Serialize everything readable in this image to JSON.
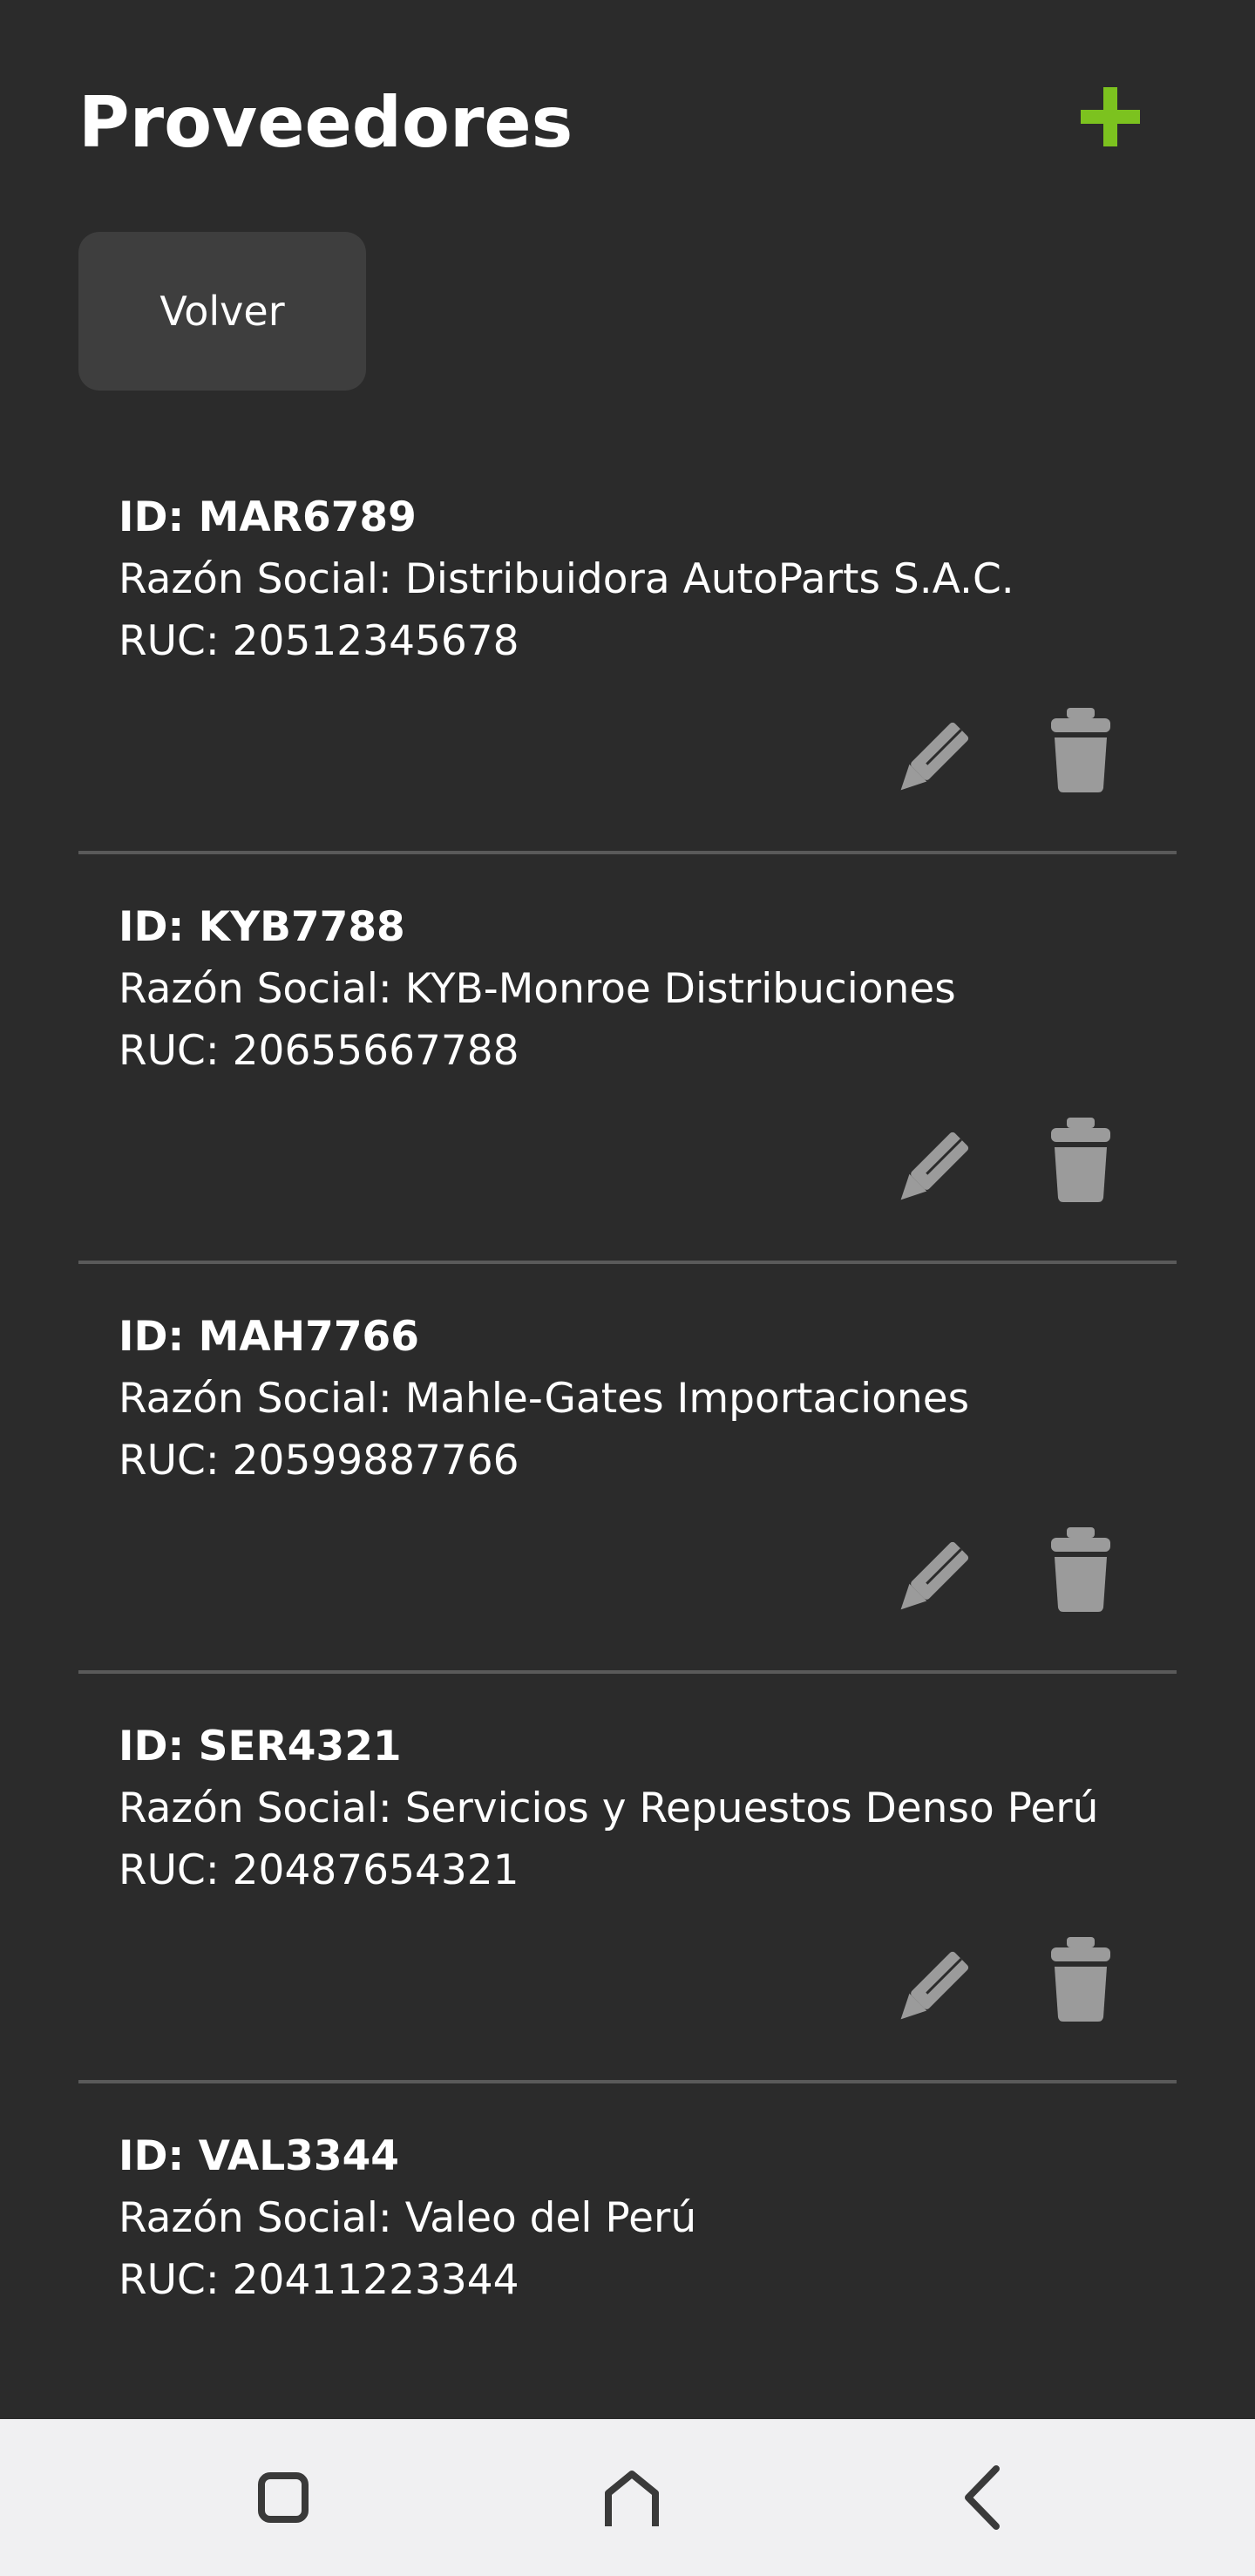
{
  "header": {
    "title": "Proveedores",
    "add_icon": "plus-icon",
    "accent_color": "#7cc21f"
  },
  "back_button": {
    "label": "Volver"
  },
  "providers": [
    {
      "id": "ID: MAR6789",
      "razon_social": "Razón Social: Distribuidora AutoParts S.A.C.",
      "ruc": "RUC: 20512345678"
    },
    {
      "id": "ID: KYB7788",
      "razon_social": "Razón Social: KYB-Monroe Distribuciones",
      "ruc": "RUC: 20655667788"
    },
    {
      "id": "ID: MAH7766",
      "razon_social": "Razón Social: Mahle-Gates Importaciones",
      "ruc": "RUC: 20599887766"
    },
    {
      "id": "ID: SER4321",
      "razon_social": "Razón Social: Servicios y Repuestos Denso Perú",
      "ruc": "RUC: 20487654321"
    },
    {
      "id": "ID: VAL3344",
      "razon_social": "Razón Social: Valeo del Perú",
      "ruc": "RUC: 20411223344"
    }
  ],
  "item_actions": {
    "edit_icon": "pencil-icon",
    "delete_icon": "trash-icon"
  },
  "nav_bar": {
    "recents_icon": "square-icon",
    "home_icon": "home-icon",
    "back_icon": "chevron-left-icon"
  },
  "colors": {
    "background": "#2b2b2b",
    "button": "#3e3e3e",
    "icon_gray": "#9b9b9b",
    "divider": "#5a5a5a",
    "nav_bar": "#f0f0f2"
  }
}
